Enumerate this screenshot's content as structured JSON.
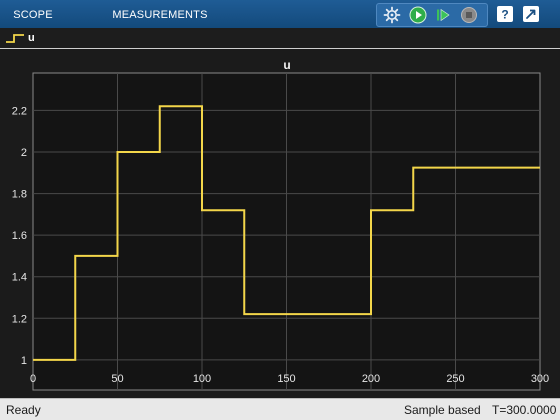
{
  "toolstrip": {
    "tabs": [
      {
        "label": "SCOPE"
      },
      {
        "label": "MEASUREMENTS"
      }
    ],
    "buttons": {
      "settings": "settings-icon",
      "run": "run-icon",
      "step": "step-forward-icon",
      "stop": "stop-icon",
      "help": "help-icon",
      "undock": "undock-icon"
    },
    "colors": {
      "toolstrip_bg": "#134a7c",
      "run_green": "#2fae4a",
      "stop_gray": "#8a8a8a"
    }
  },
  "legend": {
    "items": [
      {
        "label": "u",
        "color": "#f3d64a"
      }
    ]
  },
  "status": {
    "state": "Ready",
    "mode": "Sample based",
    "time": "T=300.0000"
  },
  "chart_data": {
    "type": "line",
    "title": "u",
    "xlabel": "",
    "ylabel": "",
    "xlim": [
      0,
      300
    ],
    "ylim": [
      0.855,
      2.38
    ],
    "xticks": [
      0,
      50,
      100,
      150,
      200,
      250,
      300
    ],
    "yticks": [
      1,
      1.2,
      1.4,
      1.6,
      1.8,
      2,
      2.2
    ],
    "ytick_labels": [
      "1",
      "1.2",
      "1.4",
      "1.6",
      "1.8",
      "2",
      "2.2"
    ],
    "grid": true,
    "background": "#141414",
    "series": [
      {
        "name": "u",
        "color": "#f3d64a",
        "step": true,
        "x": [
          0,
          25,
          50,
          75,
          100,
          125,
          150,
          175,
          200,
          225,
          250,
          275,
          300
        ],
        "values": [
          1.0,
          1.5,
          2.0,
          2.22,
          1.72,
          1.22,
          1.22,
          1.22,
          1.72,
          1.925,
          1.925,
          1.925,
          1.925
        ]
      }
    ]
  }
}
